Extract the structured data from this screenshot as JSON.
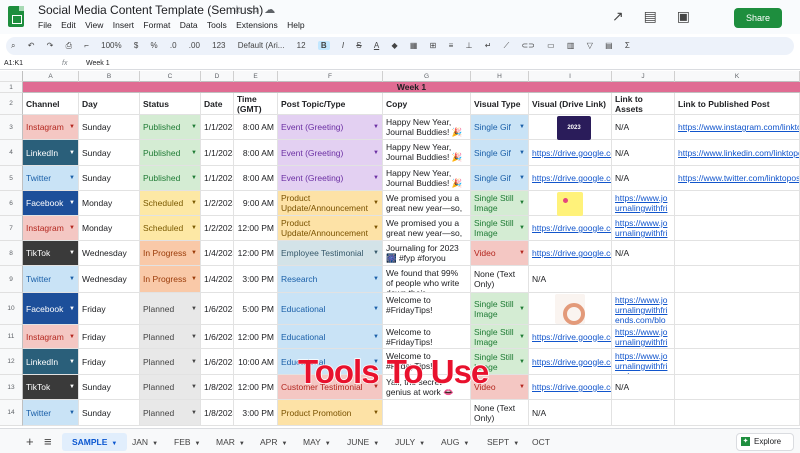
{
  "app": {
    "title": "Social Media Content Template (Semrush)",
    "menus": [
      "File",
      "Edit",
      "View",
      "Insert",
      "Format",
      "Data",
      "Tools",
      "Extensions",
      "Help"
    ],
    "share_label": "Share",
    "brand_color": "#1e8e3e"
  },
  "toolbar": {
    "zoom": "100%",
    "currency": "$",
    "percent": "%",
    "dec_less": ".0",
    "dec_more": ".00",
    "number_format": "123",
    "font": "Default (Ari...",
    "font_size": "12",
    "bold": "B",
    "italic": "I",
    "strike": "S",
    "text_color": "A"
  },
  "formula_bar": {
    "name_box": "A1:K1",
    "fx": "fx",
    "content": "Week 1"
  },
  "columns": [
    "A",
    "B",
    "C",
    "D",
    "E",
    "F",
    "G",
    "H",
    "I",
    "J",
    "K"
  ],
  "row_numbers": [
    "1",
    "2",
    "3",
    "4",
    "5",
    "6",
    "7",
    "8",
    "9",
    "10",
    "11",
    "12",
    "13",
    "14"
  ],
  "week_label": "Week 1",
  "headers": {
    "channel": "Channel",
    "day": "Day",
    "status": "Status",
    "date": "Date",
    "time": "Time (GMT)",
    "topic": "Post Topic/Type",
    "copy": "Copy",
    "visual_type": "Visual Type",
    "visual_link": "Visual (Drive Link)",
    "assets": "Link to Assets",
    "published": "Link to Published Post"
  },
  "rows": [
    {
      "channel": "Instagram",
      "day": "Sunday",
      "status": "Published",
      "date": "1/1/2023",
      "time": "8:00 AM",
      "topic": "Event (Greeting)",
      "copy": "Happy New Year, Journal Buddies! 🎉",
      "visual_type": "Single Gif",
      "visual_link": "",
      "thumb": "2023",
      "assets": "N/A",
      "published": "https://www.instagram.com/linktopost"
    },
    {
      "channel": "LinkedIn",
      "day": "Sunday",
      "status": "Published",
      "date": "1/1/2023",
      "time": "8:00 AM",
      "topic": "Event (Greeting)",
      "copy": "Happy New Year, Journal Buddies! 🎉",
      "visual_type": "Single Gif",
      "visual_link": "https://drive.google.com",
      "thumb": "",
      "assets": "N/A",
      "published": "https://www.linkedin.com/linktopost"
    },
    {
      "channel": "Twitter",
      "day": "Sunday",
      "status": "Published",
      "date": "1/1/2023",
      "time": "8:00 AM",
      "topic": "Event (Greeting)",
      "copy": "Happy New Year, Journal Buddies! 🎉",
      "visual_type": "Single Gif",
      "visual_link": "https://drive.google.com",
      "thumb": "",
      "assets": "N/A",
      "published": "https://www.twitter.com/linktopost"
    },
    {
      "channel": "Facebook",
      "day": "Monday",
      "status": "Scheduled",
      "date": "1/2/2023",
      "time": "9:00 AM",
      "topic": "Product Update/Announcement",
      "copy": "We promised you a great new year—so, we promised...",
      "visual_type": "Single Still Image",
      "visual_link": "",
      "thumb": "note",
      "assets": "https://www.journalingwithfriends.com",
      "published": ""
    },
    {
      "channel": "Instagram",
      "day": "Monday",
      "status": "Scheduled",
      "date": "1/2/2023",
      "time": "12:00 PM",
      "topic": "Product Update/Announcement",
      "copy": "We promised you a great new year—so, we promised...",
      "visual_type": "Single Still Image",
      "visual_link": "https://drive.google.com",
      "thumb": "",
      "assets": "https://www.journalingwithfriends.com",
      "published": ""
    },
    {
      "channel": "TikTok",
      "day": "Wednesday",
      "status": "In Progress",
      "date": "1/4/2023",
      "time": "12:00 PM",
      "topic": "Employee Testimonial",
      "copy": "Journaling for 2023 🎆 #fyp #foryou",
      "visual_type": "Video",
      "visual_link": "https://drive.google.com",
      "thumb": "",
      "assets": "N/A",
      "published": ""
    },
    {
      "channel": "Twitter",
      "day": "Wednesday",
      "status": "In Progress",
      "date": "1/4/2023",
      "time": "3:00 PM",
      "topic": "Research",
      "copy": "We found that 99% of people who write down their...",
      "visual_type": "None (Text Only)",
      "visual_link": "N/A",
      "thumb": "",
      "assets": "",
      "published": ""
    },
    {
      "channel": "Facebook",
      "day": "Friday",
      "status": "Planned",
      "date": "1/6/2023",
      "time": "5:00 PM",
      "topic": "Educational",
      "copy": "Welcome to #FridayTips!",
      "visual_type": "Single Still Image",
      "visual_link": "",
      "thumb": "pie",
      "assets": "https://www.journalingwithfriends.com/blog/di",
      "published": ""
    },
    {
      "channel": "Instagram",
      "day": "Friday",
      "status": "Planned",
      "date": "1/6/2023",
      "time": "12:00 PM",
      "topic": "Educational",
      "copy": "Welcome to #FridayTips!",
      "visual_type": "Single Still Image",
      "visual_link": "https://drive.google.com",
      "thumb": "",
      "assets": "https://www.journalingwithfriends.com",
      "published": ""
    },
    {
      "channel": "LinkedIn",
      "day": "Friday",
      "status": "Planned",
      "date": "1/6/2023",
      "time": "10:00 AM",
      "topic": "Educational",
      "copy": "Welcome to #FridayTips!",
      "visual_type": "Single Still Image",
      "visual_link": "https://drive.google.com",
      "thumb": "",
      "assets": "https://www.journalingwithfriends.com",
      "published": ""
    },
    {
      "channel": "TikTok",
      "day": "Sunday",
      "status": "Planned",
      "date": "1/8/2023",
      "time": "12:00 PM",
      "topic": "Customer Testimonial",
      "copy": "Yall, the secret genius at work 👄",
      "visual_type": "Video",
      "visual_link": "https://drive.google.com",
      "thumb": "",
      "assets": "N/A",
      "published": ""
    },
    {
      "channel": "Twitter",
      "day": "Sunday",
      "status": "Planned",
      "date": "1/8/2023",
      "time": "3:00 PM",
      "topic": "Product Promotion",
      "copy": "",
      "visual_type": "None (Text Only)",
      "visual_link": "N/A",
      "thumb": "",
      "assets": "",
      "published": ""
    }
  ],
  "overlay_text": "Tools To Use",
  "sheet_tabs": [
    "SAMPLE",
    "JAN",
    "FEB",
    "MAR",
    "APR",
    "MAY",
    "JUNE",
    "JULY",
    "AUG",
    "SEPT",
    "OCT"
  ],
  "explore_label": "Explore",
  "channel_colors": {
    "Instagram": {
      "bg": "#f4c7c3",
      "fg": "#b3261e"
    },
    "LinkedIn": {
      "bg": "#2a5f7a",
      "fg": "#ffffff"
    },
    "Twitter": {
      "bg": "#c9e3f6",
      "fg": "#1a5fa8"
    },
    "Facebook": {
      "bg": "#1d4f9a",
      "fg": "#ffffff"
    },
    "TikTok": {
      "bg": "#3a3a3a",
      "fg": "#ffffff"
    }
  },
  "status_colors": {
    "Published": {
      "bg": "#d4ecd3",
      "fg": "#1e7b34"
    },
    "Scheduled": {
      "bg": "#fde8a5",
      "fg": "#7a5a00"
    },
    "In Progress": {
      "bg": "#f9c9a8",
      "fg": "#9a3a08"
    },
    "Planned": {
      "bg": "#e8e8e8",
      "fg": "#444444"
    }
  },
  "topic_colors": {
    "Event (Greeting)": {
      "bg": "#e3d0f2",
      "fg": "#6b2fa3"
    },
    "Product Update/Announcement": {
      "bg": "#fde2a6",
      "fg": "#7a5200"
    },
    "Employee Testimonial": {
      "bg": "#d3e3e8",
      "fg": "#36596b"
    },
    "Research": {
      "bg": "#c9e3f6",
      "fg": "#1a5fa8"
    },
    "Educational": {
      "bg": "#c9e3f6",
      "fg": "#1a5fa8"
    },
    "Customer Testimonial": {
      "bg": "#f4c7c3",
      "fg": "#b3261e"
    },
    "Product Promotion": {
      "bg": "#fde2a6",
      "fg": "#7a5200"
    }
  },
  "visual_colors": {
    "Single Gif": {
      "bg": "#c9e3f6",
      "fg": "#1a5fa8"
    },
    "Single Still Image": {
      "bg": "#d4ecd3",
      "fg": "#1e7b34"
    },
    "Video": {
      "bg": "#f4c7c3",
      "fg": "#b3261e"
    },
    "None (Text Only)": {
      "bg": "#ffffff",
      "fg": "#202124"
    }
  }
}
